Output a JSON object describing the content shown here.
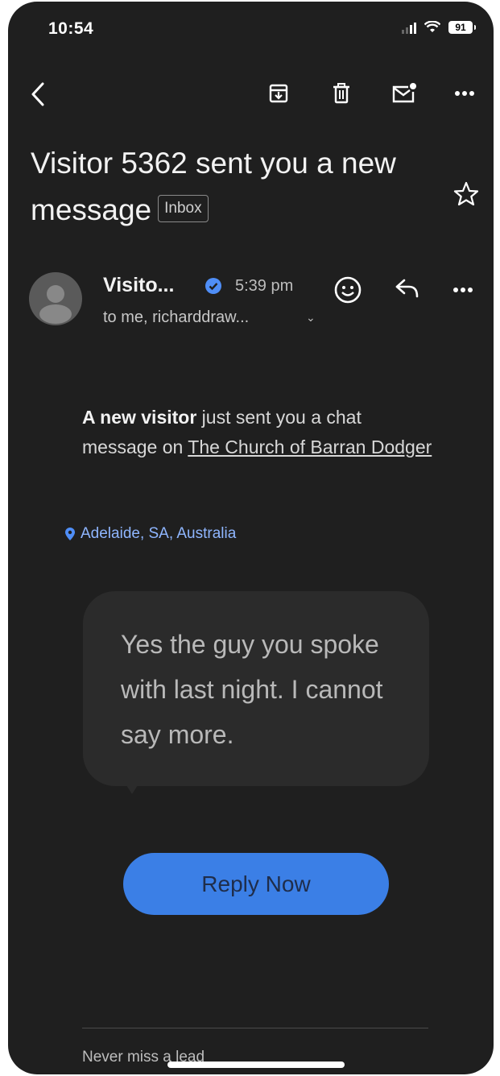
{
  "status_bar": {
    "time": "10:54",
    "battery": "91"
  },
  "subject": {
    "title": "Visitor 5362 sent you a new message",
    "label": "Inbox"
  },
  "sender": {
    "name": "Visito...",
    "time": "5:39 pm",
    "recipients": "to me, richarddraw..."
  },
  "body": {
    "intro_bold": "A new visitor",
    "intro_rest": " just sent you a chat message on ",
    "link": "The Church of Barran Dodger",
    "location": "Adelaide, SA, Australia",
    "message": "Yes the guy you spoke with last night. I cannot say more.",
    "cta": "Reply Now",
    "footer": "Never miss a lead"
  },
  "colors": {
    "background": "#1f1f1f",
    "accent": "#3b7fe6",
    "verified": "#4f8ef7",
    "location": "#8fb6ff"
  },
  "icons": [
    "back-icon",
    "archive-icon",
    "trash-icon",
    "mark-unread-icon",
    "more-icon",
    "star-icon",
    "avatar-icon",
    "verified-icon",
    "emoji-icon",
    "reply-icon",
    "location-pin-icon",
    "chevron-down-icon"
  ]
}
